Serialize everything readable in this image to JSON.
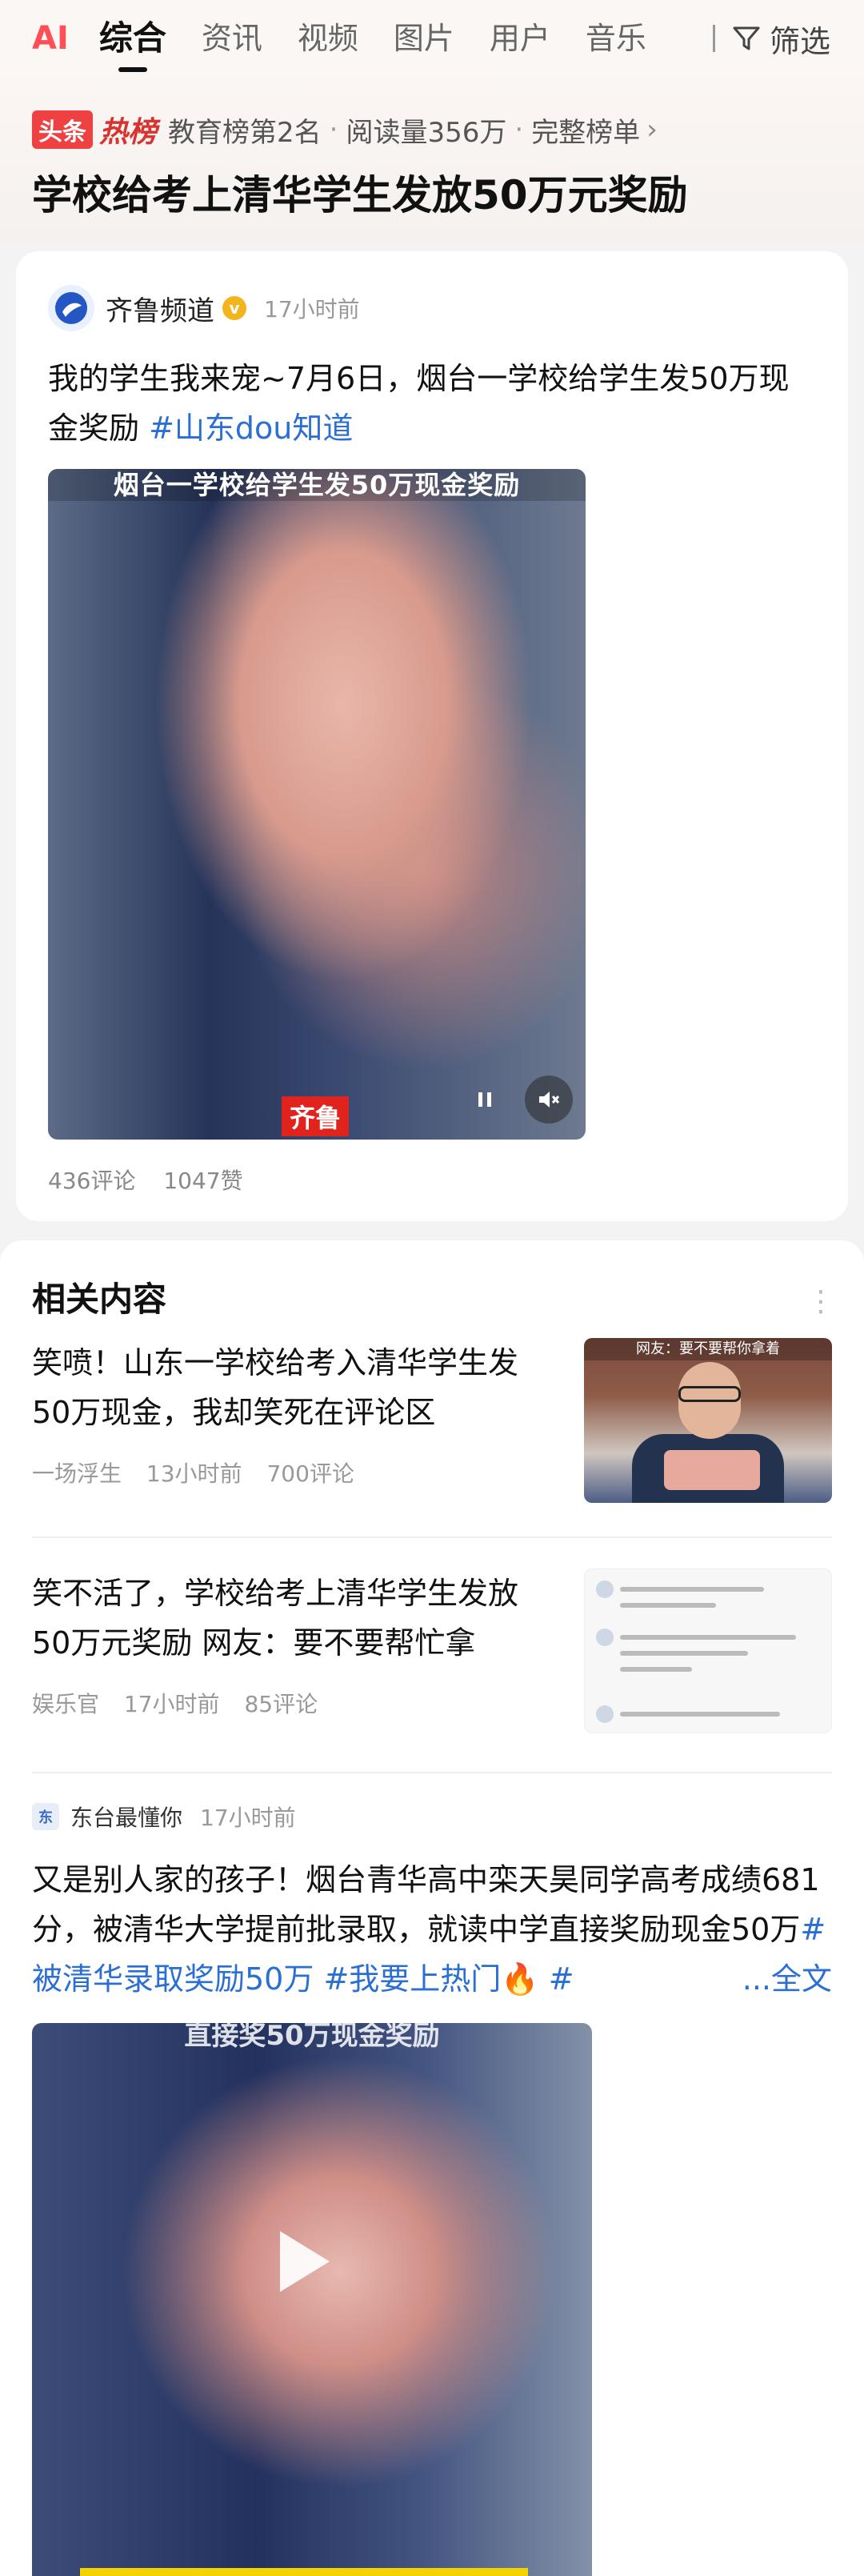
{
  "tabs": {
    "ai": "AI",
    "items": [
      "综合",
      "资讯",
      "视频",
      "图片",
      "用户",
      "音乐"
    ],
    "active": "综合",
    "filter_label": "筛选"
  },
  "hot": {
    "badge1": "头条",
    "badge2": "热榜",
    "rank_text": "教育榜第2名",
    "reads": "阅读量356万",
    "full_list": "完整榜单",
    "title": "学校给考上清华学生发放50万元奖励"
  },
  "post": {
    "source": "齐鲁频道",
    "time": "17小时前",
    "text": "我的学生我来宠~7月6日，烟台一学校给学生发50万现金奖励 ",
    "tag": "#山东dou知道",
    "video_caption": "烟台一学校给学生发50万现金奖励",
    "watermark": "齐鲁",
    "comments": "436评论",
    "likes": "1047赞"
  },
  "related": {
    "title": "相关内容",
    "items": [
      {
        "title": "笑喷！山东一学校给考入清华学生发50万现金，我却笑死在评论区",
        "author": "一场浮生",
        "time": "13小时前",
        "comments": "700评论",
        "thumb_caption": "网友：要不要帮你拿着"
      },
      {
        "title": "笑不活了，学校给考上清华学生发放50万元奖励 网友：要不要帮忙拿",
        "author": "娱乐官",
        "time": "17小时前",
        "comments": "85评论"
      }
    ]
  },
  "feed": {
    "source": "东台最懂你",
    "time": "17小时前",
    "text": "又是别人家的孩子！烟台青华高中栾天昊同学高考成绩681分，被清华大学提前批录取，就读中学直接奖励现金50万",
    "tag1": "#被清华录取奖励50万",
    "tag2": "#我要上热门",
    "tag3": "#",
    "expand": "...全文",
    "video_caption": "直接奖50万现金奖励"
  },
  "colors": {
    "accent_red": "#f04142",
    "link_blue": "#2b6fd4",
    "background": "#f3f3f3"
  }
}
